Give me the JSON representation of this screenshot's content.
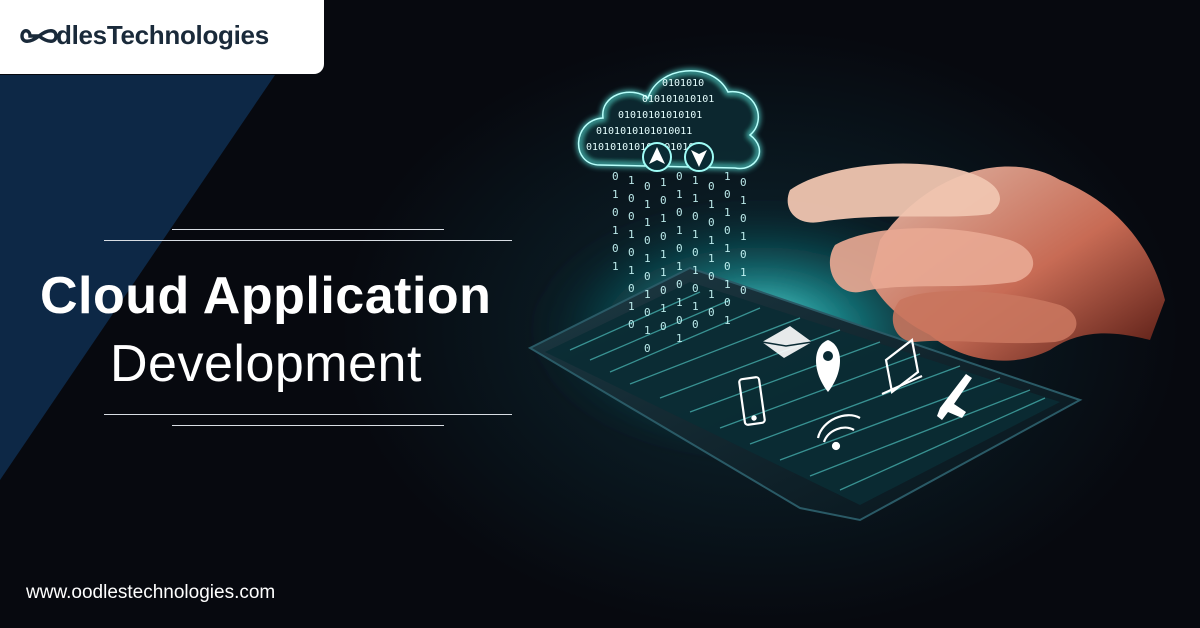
{
  "brand": {
    "logo_text": "dlesTechnologies",
    "logo_icon": "infinity-icon"
  },
  "headline": {
    "line1": "Cloud Application",
    "line2": "Development"
  },
  "footer": {
    "url": "www.oodlestechnologies.com"
  },
  "illustration": {
    "cloud_binary_rows": [
      "0101010",
      "010101010101",
      "01010101010101",
      "0101010101010011",
      "010101010100101010"
    ],
    "icons": [
      "upload-arrow-icon",
      "download-arrow-icon",
      "mail-icon",
      "location-pin-icon",
      "laptop-icon",
      "airplane-icon",
      "tablet-icon",
      "wifi-icon"
    ]
  },
  "colors": {
    "navy": "#0e2a4a",
    "glow": "#4ff0e6",
    "background": "#07090f",
    "text": "#ffffff"
  }
}
